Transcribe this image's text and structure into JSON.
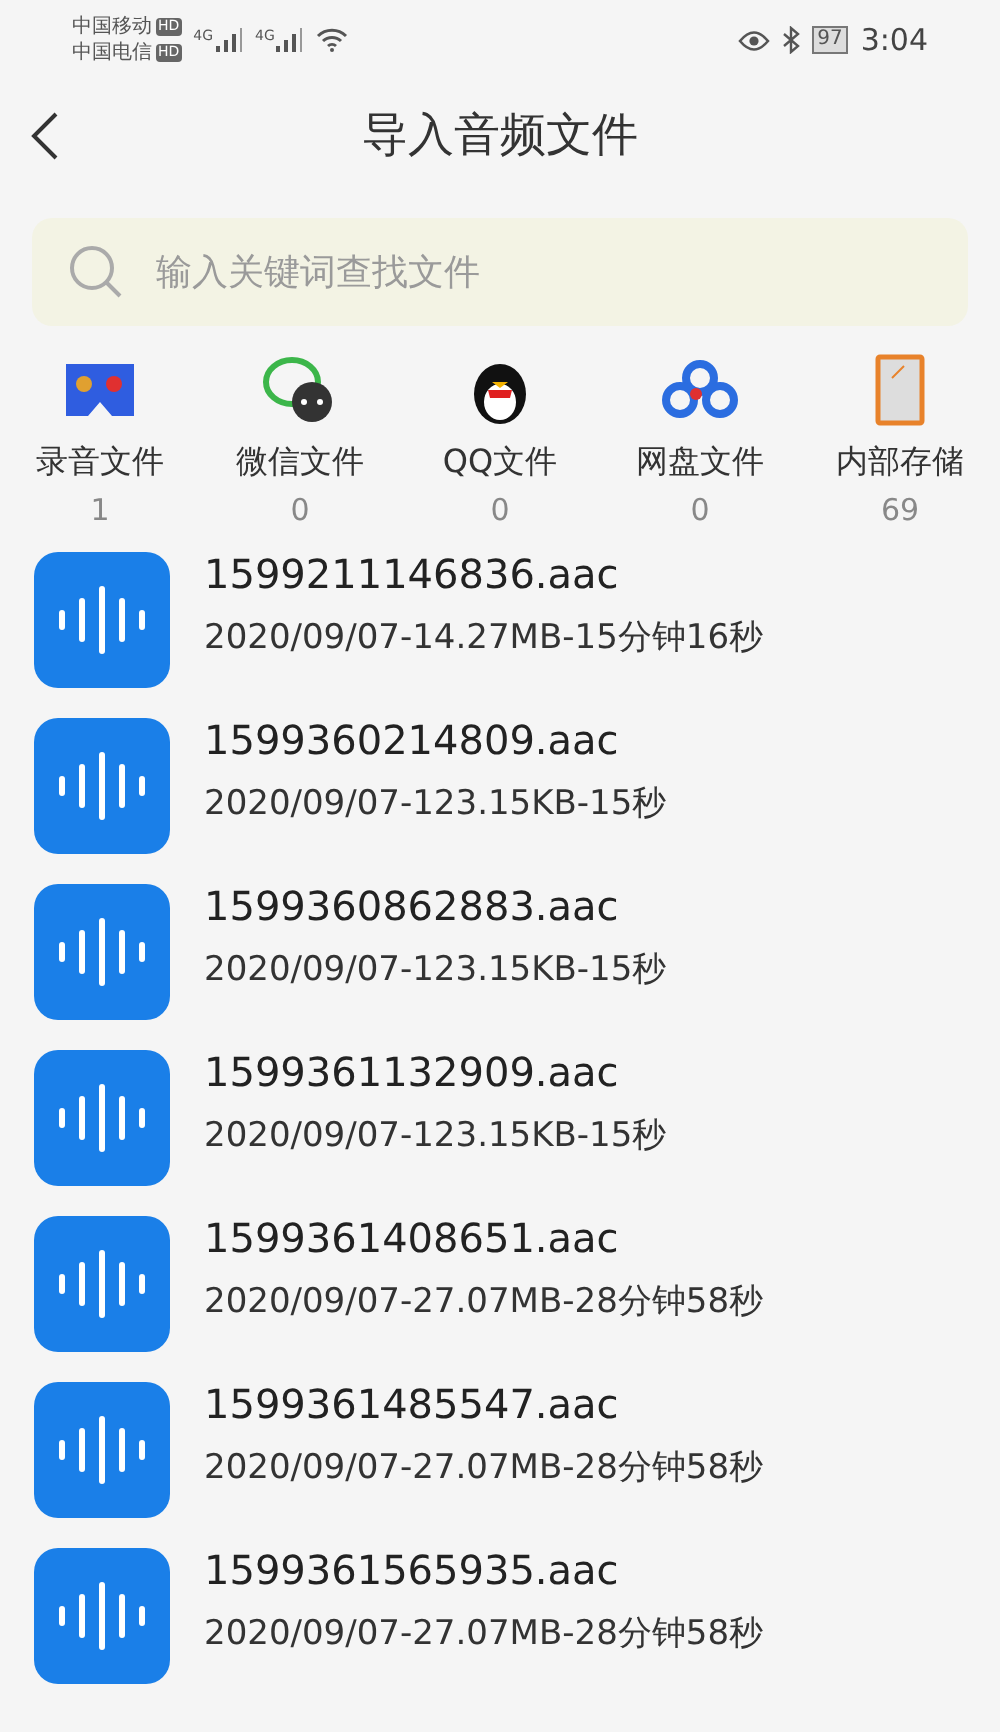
{
  "status_bar": {
    "carriers": [
      {
        "name": "中国移动",
        "badge": "HD"
      },
      {
        "name": "中国电信",
        "badge": "HD"
      }
    ],
    "signals": [
      "4G",
      "4G"
    ],
    "battery": "97",
    "time": "3:04"
  },
  "header": {
    "title": "导入音频文件"
  },
  "search": {
    "placeholder": "输入关键词查找文件"
  },
  "categories": [
    {
      "kind": "recorder",
      "label": "录音文件",
      "count": "1"
    },
    {
      "kind": "wechat",
      "label": "微信文件",
      "count": "0"
    },
    {
      "kind": "qq",
      "label": "QQ文件",
      "count": "0"
    },
    {
      "kind": "cloud",
      "label": "网盘文件",
      "count": "0"
    },
    {
      "kind": "phone",
      "label": "内部存储",
      "count": "69"
    }
  ],
  "files": [
    {
      "name": "1599211146836.aac",
      "info": "2020/09/07-14.27MB-15分钟16秒"
    },
    {
      "name": "1599360214809.aac",
      "info": "2020/09/07-123.15KB-15秒"
    },
    {
      "name": "1599360862883.aac",
      "info": "2020/09/07-123.15KB-15秒"
    },
    {
      "name": "1599361132909.aac",
      "info": "2020/09/07-123.15KB-15秒"
    },
    {
      "name": "1599361408651.aac",
      "info": "2020/09/07-27.07MB-28分钟58秒"
    },
    {
      "name": "1599361485547.aac",
      "info": "2020/09/07-27.07MB-28分钟58秒"
    },
    {
      "name": "1599361565935.aac",
      "info": "2020/09/07-27.07MB-28分钟58秒"
    }
  ]
}
